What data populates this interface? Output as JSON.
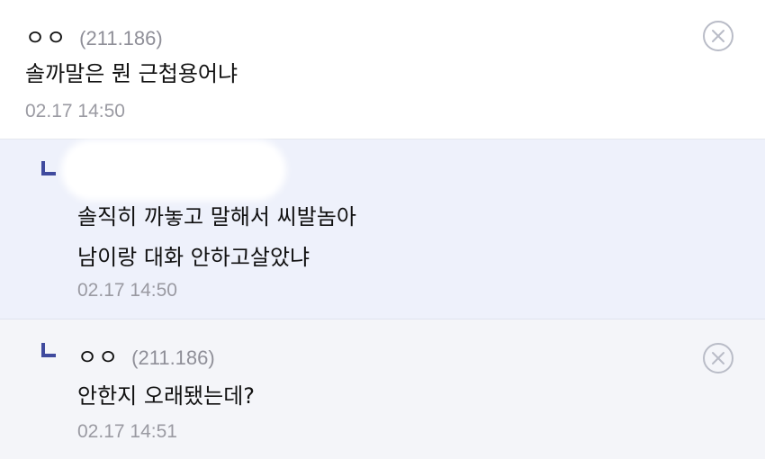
{
  "colors": {
    "reply_marker": "#3f4a9e",
    "reply_highlight_bg": "#eef1fb",
    "reply_bg": "#f4f5f9",
    "meta_text": "#9a9aa2"
  },
  "icons": {
    "delete": "close-circle-icon",
    "reply": "reply-arrow-icon"
  },
  "comments": [
    {
      "nickname": "ㅇㅇ",
      "ip": "(211.186)",
      "text": "솔까말은 뭔 근첩용어냐",
      "timestamp": "02.17 14:50"
    },
    {
      "nickname": "",
      "ip": "",
      "lines": [
        "솔직히 까놓고 말해서 씨발놈아",
        "남이랑 대화 안하고살았냐"
      ],
      "timestamp": "02.17 14:50"
    },
    {
      "nickname": "ㅇㅇ",
      "ip": "(211.186)",
      "text": "안한지 오래됐는데?",
      "timestamp": "02.17 14:51"
    }
  ]
}
